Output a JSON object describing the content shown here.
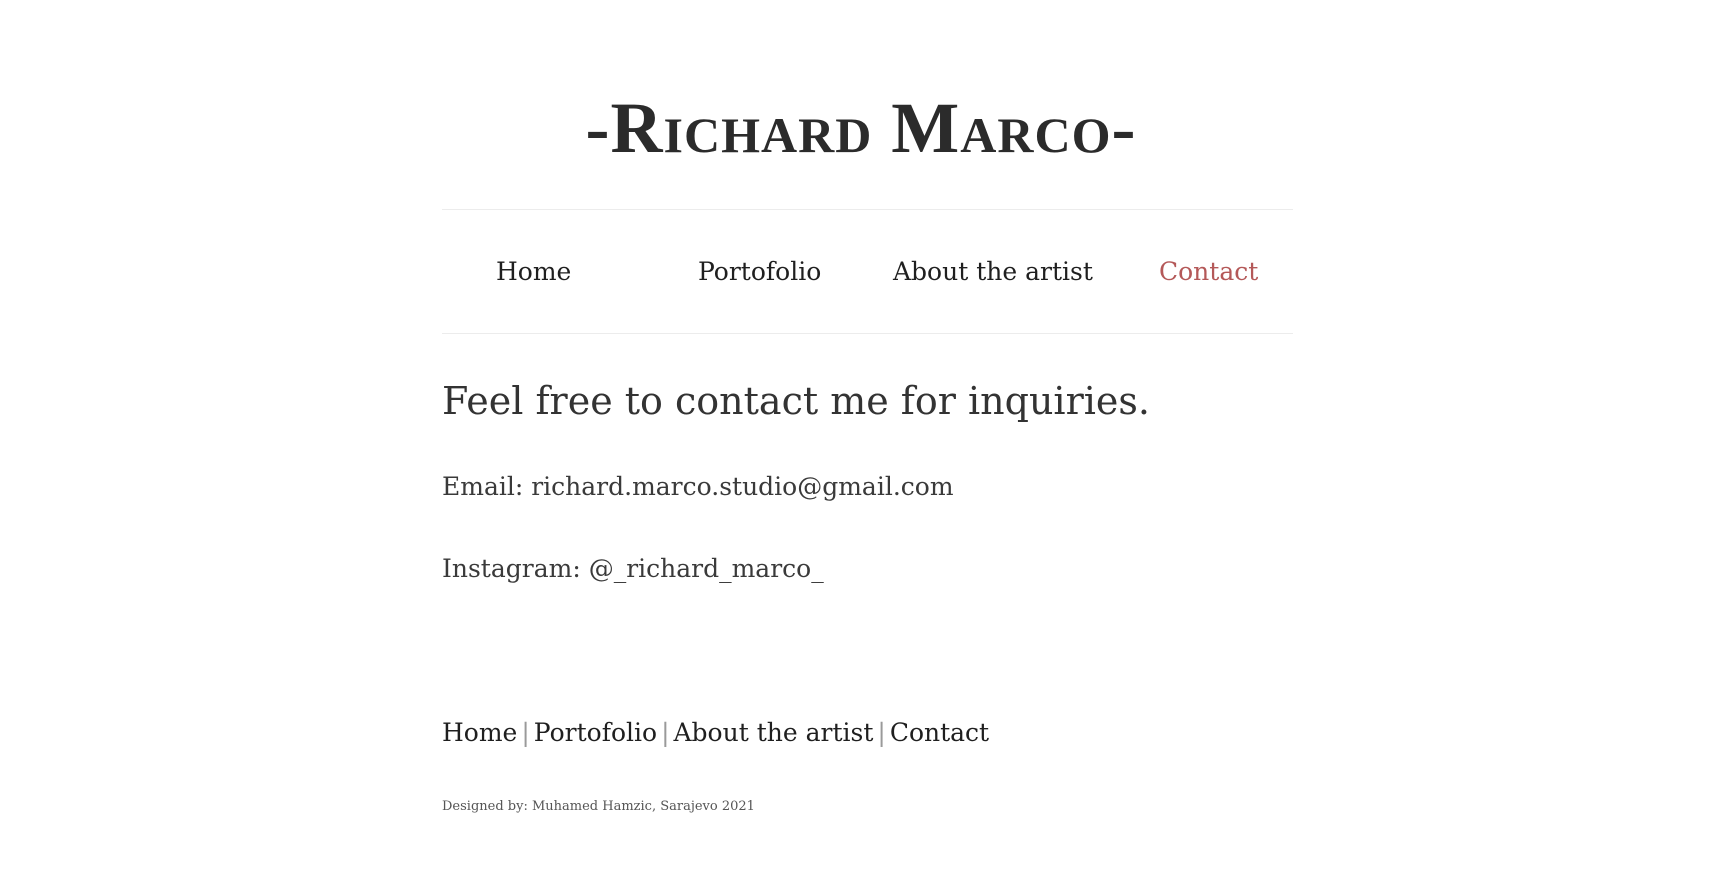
{
  "header": {
    "title": "-Richard Marco-"
  },
  "nav": {
    "items": [
      {
        "label": "Home"
      },
      {
        "label": "Portofolio"
      },
      {
        "label": "About the artist"
      },
      {
        "label": "Contact"
      }
    ],
    "active": "Contact",
    "active_color": "#b45858"
  },
  "main": {
    "heading": "Feel free to contact me for inquiries.",
    "email_line": "Email: richard.marco.studio@gmail.com",
    "instagram_line": "Instagram: @_richard_marco_"
  },
  "footer": {
    "links": [
      {
        "label": "Home"
      },
      {
        "label": "Portofolio"
      },
      {
        "label": "About the artist"
      },
      {
        "label": "Contact"
      }
    ],
    "separator": "|",
    "credit": "Designed by: Muhamed Hamzic, Sarajevo 2021"
  }
}
